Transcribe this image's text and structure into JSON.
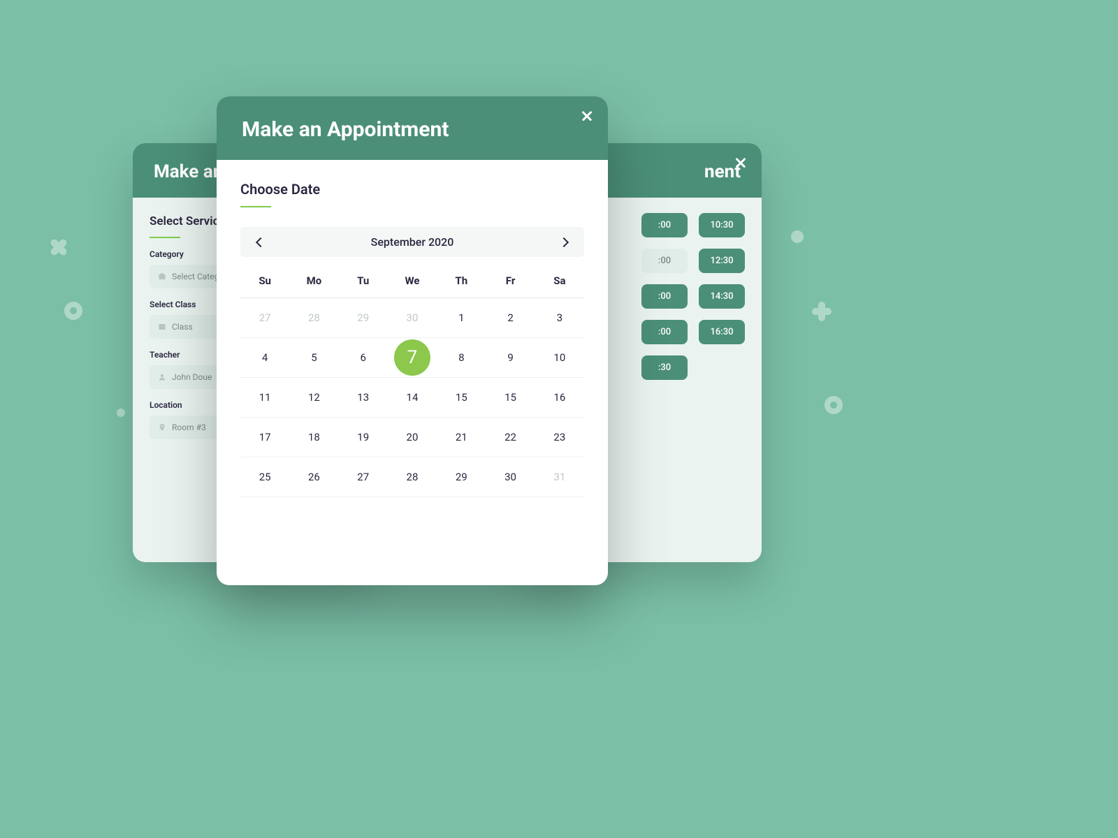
{
  "header_title": "Make an Appointment",
  "left": {
    "section_title": "Select Service",
    "fields": {
      "category": {
        "label": "Category",
        "value": "Select Category"
      },
      "class": {
        "label": "Select Class",
        "value": "Class"
      },
      "teacher": {
        "label": "Teacher",
        "value": "John Doue"
      },
      "location": {
        "label": "Location",
        "value": "Room #3"
      }
    }
  },
  "center": {
    "section_title": "Choose Date",
    "month_label": "September 2020",
    "weekdays": [
      "Su",
      "Mo",
      "Tu",
      "We",
      "Th",
      "Fr",
      "Sa"
    ],
    "weeks": [
      [
        {
          "d": "27",
          "muted": true
        },
        {
          "d": "28",
          "muted": true
        },
        {
          "d": "29",
          "muted": true
        },
        {
          "d": "30",
          "muted": true
        },
        {
          "d": "1"
        },
        {
          "d": "2"
        },
        {
          "d": "3"
        }
      ],
      [
        {
          "d": "4"
        },
        {
          "d": "5"
        },
        {
          "d": "6"
        },
        {
          "d": "7",
          "selected": true
        },
        {
          "d": "8"
        },
        {
          "d": "9"
        },
        {
          "d": "10"
        }
      ],
      [
        {
          "d": "11"
        },
        {
          "d": "12"
        },
        {
          "d": "13"
        },
        {
          "d": "14"
        },
        {
          "d": "15"
        },
        {
          "d": "15"
        },
        {
          "d": "16"
        }
      ],
      [
        {
          "d": "17"
        },
        {
          "d": "18"
        },
        {
          "d": "19"
        },
        {
          "d": "20"
        },
        {
          "d": "21"
        },
        {
          "d": "22"
        },
        {
          "d": "23"
        }
      ],
      [
        {
          "d": "25"
        },
        {
          "d": "26"
        },
        {
          "d": "27"
        },
        {
          "d": "28"
        },
        {
          "d": "29"
        },
        {
          "d": "30"
        },
        {
          "d": "31",
          "muted": true
        }
      ]
    ]
  },
  "right": {
    "title_fragment": "nent",
    "rows": [
      [
        {
          "t": ":00"
        },
        {
          "t": "10:30"
        }
      ],
      [
        {
          "t": ":00",
          "muted": true
        },
        {
          "t": "12:30"
        }
      ],
      [
        {
          "t": ":00"
        },
        {
          "t": "14:30"
        }
      ],
      [
        {
          "t": ":00"
        },
        {
          "t": "16:30"
        }
      ],
      [
        {
          "t": ":30",
          "solo": true
        }
      ]
    ]
  }
}
